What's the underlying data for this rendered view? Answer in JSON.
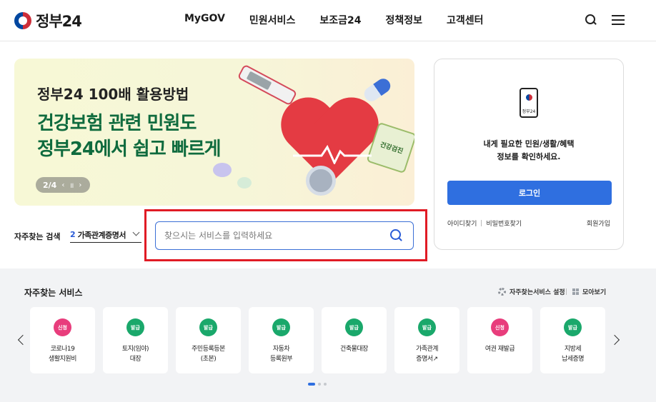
{
  "header": {
    "logo_text": "정부24",
    "nav": [
      "MyGOV",
      "민원서비스",
      "보조금24",
      "정책정보",
      "고객센터"
    ],
    "icons": [
      "search-icon",
      "menu-icon"
    ]
  },
  "banner": {
    "subtitle": "정부24 100배 활용방법",
    "title_line1": "건강보험 관련 민원도",
    "title_line2": "정부24에서 쉽고 빠르게",
    "pager_count": "2/4",
    "pager_prev": "‹",
    "pager_pause": "॥",
    "pager_next": "›",
    "calendar_text": "건강검진"
  },
  "quick_search": {
    "label": "자주찾는 검색",
    "selected_number": "2",
    "selected_text": "가족관계증명서",
    "search_placeholder": "찾으시는 서비스를 입력하세요",
    "search_value": ""
  },
  "login_card": {
    "phone_label": "정부24",
    "message_line1": "내게 필요한 민원/생활/혜택",
    "message_line2": "정보를 확인하세요.",
    "login_label": "로그인",
    "find_id": "아이디찾기",
    "find_password": "비밀번호찾기",
    "signup": "회원가입"
  },
  "frequent_services": {
    "title": "자주찾는 서비스",
    "settings_label": "자주찾는서비스 설정",
    "gather_label": "모아보기",
    "items": [
      {
        "badge": "신청",
        "type": "apply",
        "name": "코로나19\n생활지원비"
      },
      {
        "badge": "발급",
        "type": "issue",
        "name": "토지(임야)\n대장"
      },
      {
        "badge": "발급",
        "type": "issue",
        "name": "주민등록등본\n(초본)"
      },
      {
        "badge": "발급",
        "type": "issue",
        "name": "자동차\n등록원부"
      },
      {
        "badge": "발급",
        "type": "issue",
        "name": "건축물대장"
      },
      {
        "badge": "발급",
        "type": "issue",
        "name": "가족관계\n증명서↗"
      },
      {
        "badge": "신청",
        "type": "apply",
        "name": "여권 재발급"
      },
      {
        "badge": "발급",
        "type": "issue",
        "name": "지방세\n납세증명"
      }
    ]
  },
  "colors": {
    "accent_blue": "#2f6fe0",
    "highlight_red": "#e01b25",
    "banner_green": "#0f6b3e",
    "badge_apply": "#e83d7c",
    "badge_issue": "#1aa86b"
  }
}
